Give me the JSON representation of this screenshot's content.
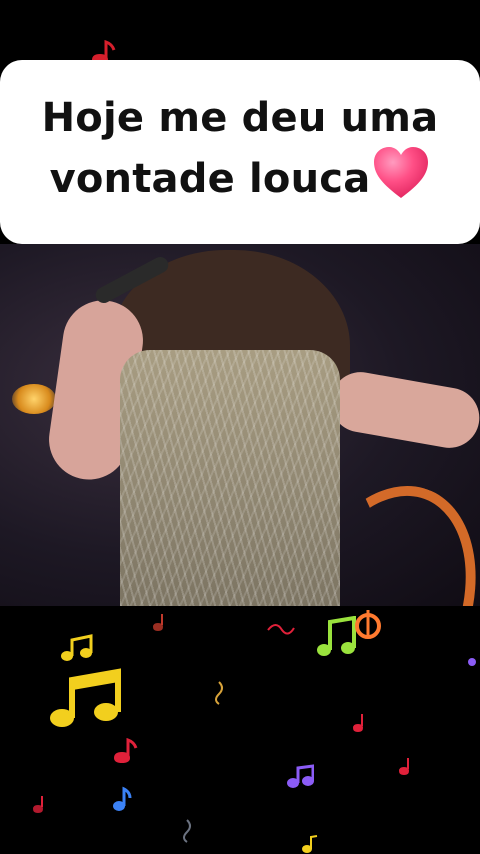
{
  "caption": {
    "line1": "Hoje me deu uma",
    "line2": "vontade louca"
  },
  "icons": {
    "caption_emoji": "pink-heart-icon",
    "notes": "music-note-icons"
  },
  "colors": {
    "caption_bg": "#ffffff",
    "caption_text": "#111111",
    "heart": "#ff4f86",
    "note_yellow": "#f2cf1e",
    "note_green": "#9ae23d",
    "note_red": "#e0213a",
    "note_orange": "#ff7a2f",
    "note_purple": "#8b5cf6",
    "note_blue": "#3b82f6"
  }
}
